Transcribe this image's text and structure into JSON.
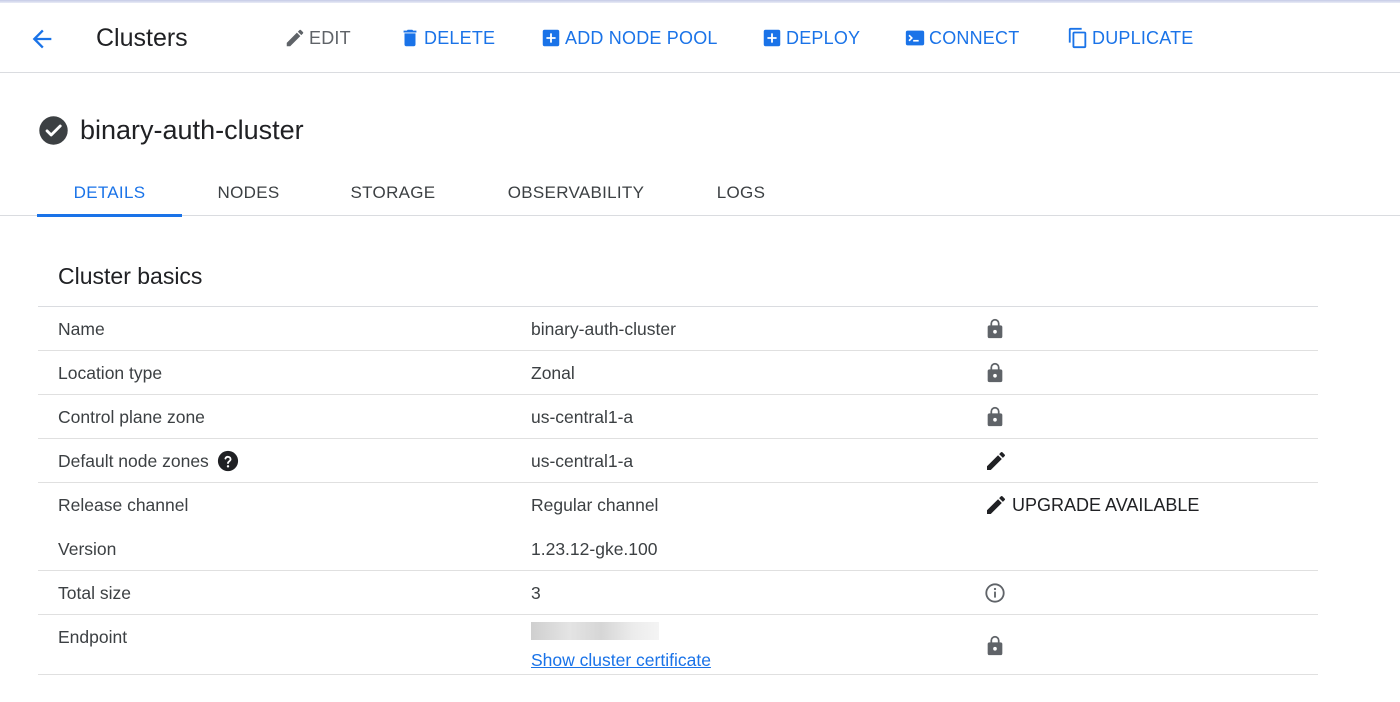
{
  "toolbar": {
    "title": "Clusters",
    "actions": [
      {
        "label": "EDIT",
        "icon": "pencil-icon",
        "enabled": false
      },
      {
        "label": "DELETE",
        "icon": "trash-icon",
        "enabled": true
      },
      {
        "label": "ADD NODE POOL",
        "icon": "add-box-icon",
        "enabled": true
      },
      {
        "label": "DEPLOY",
        "icon": "add-box-icon",
        "enabled": true
      },
      {
        "label": "CONNECT",
        "icon": "terminal-icon",
        "enabled": true
      },
      {
        "label": "DUPLICATE",
        "icon": "copy-icon",
        "enabled": true
      }
    ]
  },
  "cluster": {
    "name": "binary-auth-cluster",
    "status_icon": "check-circle-icon"
  },
  "tabs": [
    {
      "label": "DETAILS",
      "active": true
    },
    {
      "label": "NODES",
      "active": false
    },
    {
      "label": "STORAGE",
      "active": false
    },
    {
      "label": "OBSERVABILITY",
      "active": false
    },
    {
      "label": "LOGS",
      "active": false
    }
  ],
  "section": {
    "title": "Cluster basics",
    "rows": [
      {
        "label": "Name",
        "value": "binary-auth-cluster",
        "action_icon": "lock-icon"
      },
      {
        "label": "Location type",
        "value": "Zonal",
        "action_icon": "lock-icon"
      },
      {
        "label": "Control plane zone",
        "value": "us-central1-a",
        "action_icon": "lock-icon"
      },
      {
        "label": "Default node zones",
        "value": "us-central1-a",
        "action_icon": "edit-icon",
        "label_icon": "help-icon"
      },
      {
        "label": "Release channel",
        "value": "Regular channel",
        "action_icon": "edit-icon",
        "action_label": "UPGRADE AVAILABLE"
      },
      {
        "label": "Version",
        "value": "1.23.12-gke.100"
      },
      {
        "label": "Total size",
        "value": "3",
        "action_icon": "info-icon"
      },
      {
        "label": "Endpoint",
        "link": "Show cluster certificate",
        "action_icon": "lock-icon"
      }
    ]
  },
  "colors": {
    "accent": "#1a73e8",
    "text": "#202124",
    "divider": "#dadce0",
    "icon": "#5f6368"
  }
}
